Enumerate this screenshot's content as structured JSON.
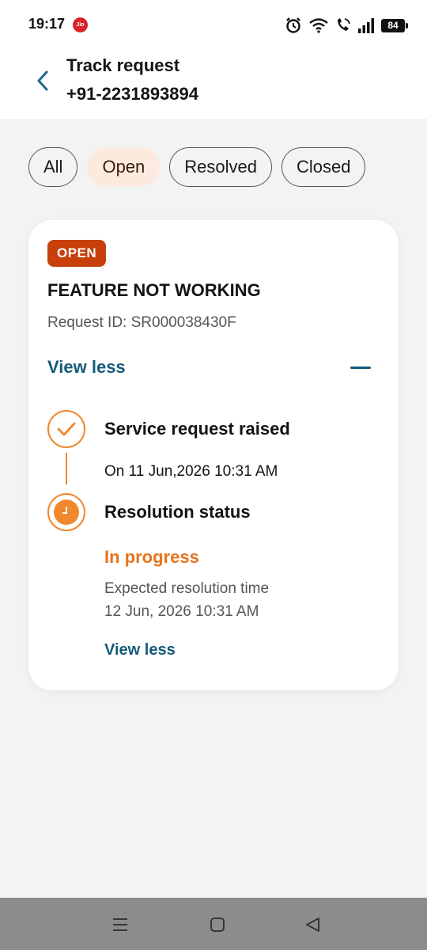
{
  "status_bar": {
    "time": "19:17",
    "carrier": "Jio",
    "battery": "84",
    "icons": [
      "alarm-icon",
      "wifi-icon",
      "wifi-calling-icon",
      "signal-icon",
      "battery-icon"
    ]
  },
  "header": {
    "title": "Track request",
    "phone": "+91-2231893894",
    "back_icon": "chevron-left-icon"
  },
  "filters": {
    "items": [
      "All",
      "Open",
      "Resolved",
      "Closed"
    ],
    "selected": "Open"
  },
  "card": {
    "badge": "OPEN",
    "title": "FEATURE NOT WORKING",
    "request_id": "Request ID: SR000038430F",
    "view_less": "View less",
    "timeline": [
      {
        "title": "Service request raised",
        "detail": "On 11 Jun,2026 10:31 AM",
        "icon": "check-icon"
      },
      {
        "title": "Resolution status",
        "status": "In progress",
        "expected_label": "Expected resolution time",
        "expected_date": "12 Jun, 2026 10:31 AM",
        "icon": "clock-icon"
      }
    ],
    "view_less_bottom": "View less"
  },
  "colors": {
    "accent_orange": "#f0882e",
    "badge": "#c7400c",
    "link": "#135a7a",
    "status_text": "#e9731c",
    "chip_selected_bg": "#fdeadf"
  },
  "nav_bar": {
    "icons": [
      "menu-icon",
      "home-icon",
      "back-icon"
    ]
  }
}
